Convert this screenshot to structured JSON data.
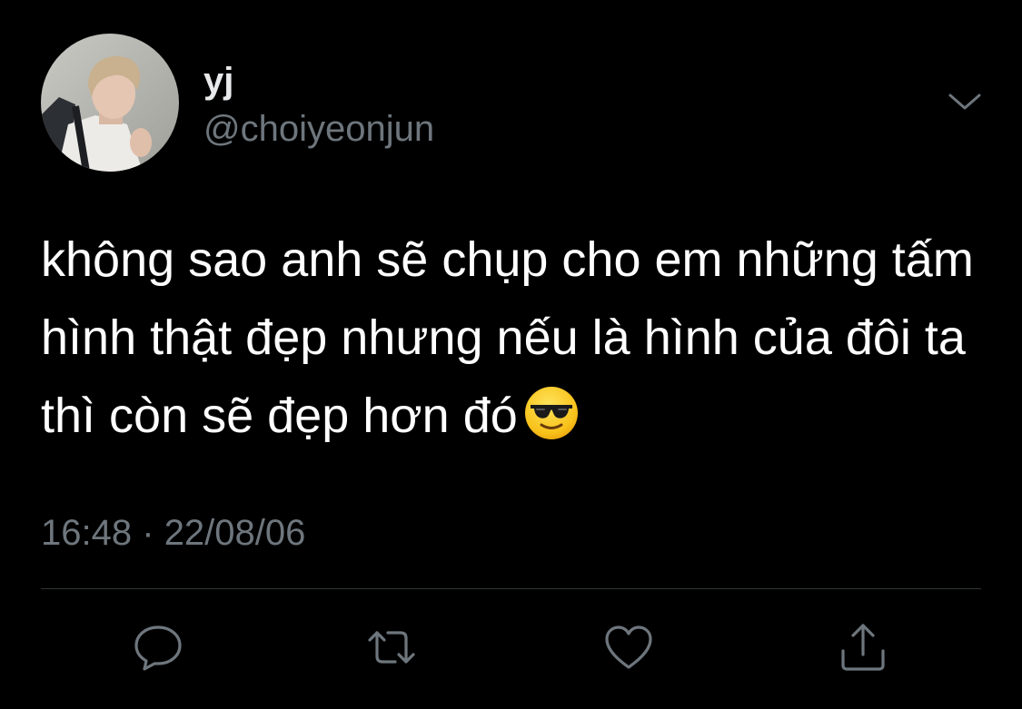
{
  "user": {
    "display_name": "yj",
    "handle": "@choiyeonjun"
  },
  "tweet": {
    "text": "không sao anh sẽ chụp cho em những tấm hình thật đẹp nhưng nếu là hình của đôi ta thì còn sẽ đẹp hơn đó",
    "emoji": "smiling-face-with-sunglasses",
    "time": "16:48",
    "separator": "·",
    "date": "22/08/06"
  },
  "actions": [
    {
      "name": "reply",
      "icon": "speech-bubble-icon"
    },
    {
      "name": "retweet",
      "icon": "retweet-arrows-icon"
    },
    {
      "name": "like",
      "icon": "heart-icon"
    },
    {
      "name": "share",
      "icon": "share-upload-icon"
    }
  ],
  "colors": {
    "background": "#000000",
    "primary_text": "#ffffff",
    "secondary_text": "#6e767d",
    "divider": "#2f3336",
    "icon": "#6e767d"
  }
}
